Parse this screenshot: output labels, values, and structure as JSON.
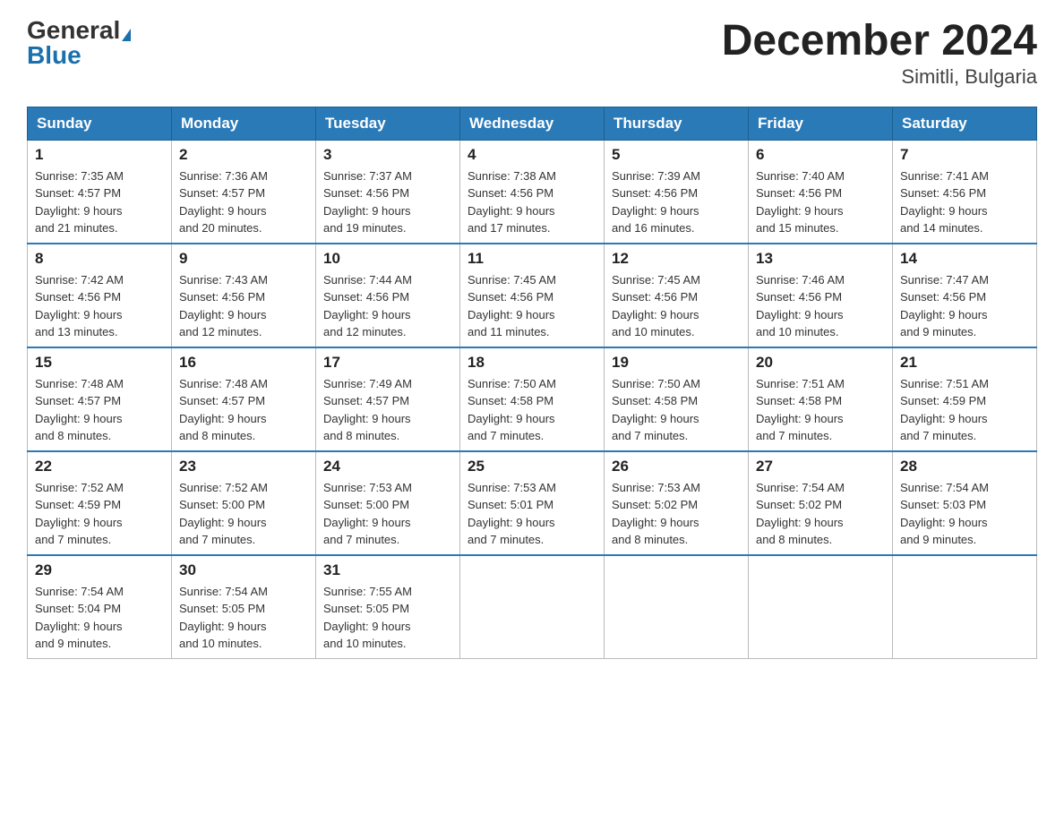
{
  "header": {
    "logo_general": "General",
    "logo_blue": "Blue",
    "month_year": "December 2024",
    "location": "Simitli, Bulgaria"
  },
  "days_of_week": [
    "Sunday",
    "Monday",
    "Tuesday",
    "Wednesday",
    "Thursday",
    "Friday",
    "Saturday"
  ],
  "weeks": [
    [
      {
        "day": "1",
        "sunrise": "7:35 AM",
        "sunset": "4:57 PM",
        "daylight": "9 hours and 21 minutes."
      },
      {
        "day": "2",
        "sunrise": "7:36 AM",
        "sunset": "4:57 PM",
        "daylight": "9 hours and 20 minutes."
      },
      {
        "day": "3",
        "sunrise": "7:37 AM",
        "sunset": "4:56 PM",
        "daylight": "9 hours and 19 minutes."
      },
      {
        "day": "4",
        "sunrise": "7:38 AM",
        "sunset": "4:56 PM",
        "daylight": "9 hours and 17 minutes."
      },
      {
        "day": "5",
        "sunrise": "7:39 AM",
        "sunset": "4:56 PM",
        "daylight": "9 hours and 16 minutes."
      },
      {
        "day": "6",
        "sunrise": "7:40 AM",
        "sunset": "4:56 PM",
        "daylight": "9 hours and 15 minutes."
      },
      {
        "day": "7",
        "sunrise": "7:41 AM",
        "sunset": "4:56 PM",
        "daylight": "9 hours and 14 minutes."
      }
    ],
    [
      {
        "day": "8",
        "sunrise": "7:42 AM",
        "sunset": "4:56 PM",
        "daylight": "9 hours and 13 minutes."
      },
      {
        "day": "9",
        "sunrise": "7:43 AM",
        "sunset": "4:56 PM",
        "daylight": "9 hours and 12 minutes."
      },
      {
        "day": "10",
        "sunrise": "7:44 AM",
        "sunset": "4:56 PM",
        "daylight": "9 hours and 12 minutes."
      },
      {
        "day": "11",
        "sunrise": "7:45 AM",
        "sunset": "4:56 PM",
        "daylight": "9 hours and 11 minutes."
      },
      {
        "day": "12",
        "sunrise": "7:45 AM",
        "sunset": "4:56 PM",
        "daylight": "9 hours and 10 minutes."
      },
      {
        "day": "13",
        "sunrise": "7:46 AM",
        "sunset": "4:56 PM",
        "daylight": "9 hours and 10 minutes."
      },
      {
        "day": "14",
        "sunrise": "7:47 AM",
        "sunset": "4:56 PM",
        "daylight": "9 hours and 9 minutes."
      }
    ],
    [
      {
        "day": "15",
        "sunrise": "7:48 AM",
        "sunset": "4:57 PM",
        "daylight": "9 hours and 8 minutes."
      },
      {
        "day": "16",
        "sunrise": "7:48 AM",
        "sunset": "4:57 PM",
        "daylight": "9 hours and 8 minutes."
      },
      {
        "day": "17",
        "sunrise": "7:49 AM",
        "sunset": "4:57 PM",
        "daylight": "9 hours and 8 minutes."
      },
      {
        "day": "18",
        "sunrise": "7:50 AM",
        "sunset": "4:58 PM",
        "daylight": "9 hours and 7 minutes."
      },
      {
        "day": "19",
        "sunrise": "7:50 AM",
        "sunset": "4:58 PM",
        "daylight": "9 hours and 7 minutes."
      },
      {
        "day": "20",
        "sunrise": "7:51 AM",
        "sunset": "4:58 PM",
        "daylight": "9 hours and 7 minutes."
      },
      {
        "day": "21",
        "sunrise": "7:51 AM",
        "sunset": "4:59 PM",
        "daylight": "9 hours and 7 minutes."
      }
    ],
    [
      {
        "day": "22",
        "sunrise": "7:52 AM",
        "sunset": "4:59 PM",
        "daylight": "9 hours and 7 minutes."
      },
      {
        "day": "23",
        "sunrise": "7:52 AM",
        "sunset": "5:00 PM",
        "daylight": "9 hours and 7 minutes."
      },
      {
        "day": "24",
        "sunrise": "7:53 AM",
        "sunset": "5:00 PM",
        "daylight": "9 hours and 7 minutes."
      },
      {
        "day": "25",
        "sunrise": "7:53 AM",
        "sunset": "5:01 PM",
        "daylight": "9 hours and 7 minutes."
      },
      {
        "day": "26",
        "sunrise": "7:53 AM",
        "sunset": "5:02 PM",
        "daylight": "9 hours and 8 minutes."
      },
      {
        "day": "27",
        "sunrise": "7:54 AM",
        "sunset": "5:02 PM",
        "daylight": "9 hours and 8 minutes."
      },
      {
        "day": "28",
        "sunrise": "7:54 AM",
        "sunset": "5:03 PM",
        "daylight": "9 hours and 9 minutes."
      }
    ],
    [
      {
        "day": "29",
        "sunrise": "7:54 AM",
        "sunset": "5:04 PM",
        "daylight": "9 hours and 9 minutes."
      },
      {
        "day": "30",
        "sunrise": "7:54 AM",
        "sunset": "5:05 PM",
        "daylight": "9 hours and 10 minutes."
      },
      {
        "day": "31",
        "sunrise": "7:55 AM",
        "sunset": "5:05 PM",
        "daylight": "9 hours and 10 minutes."
      },
      null,
      null,
      null,
      null
    ]
  ],
  "labels": {
    "sunrise": "Sunrise:",
    "sunset": "Sunset:",
    "daylight": "Daylight:"
  }
}
